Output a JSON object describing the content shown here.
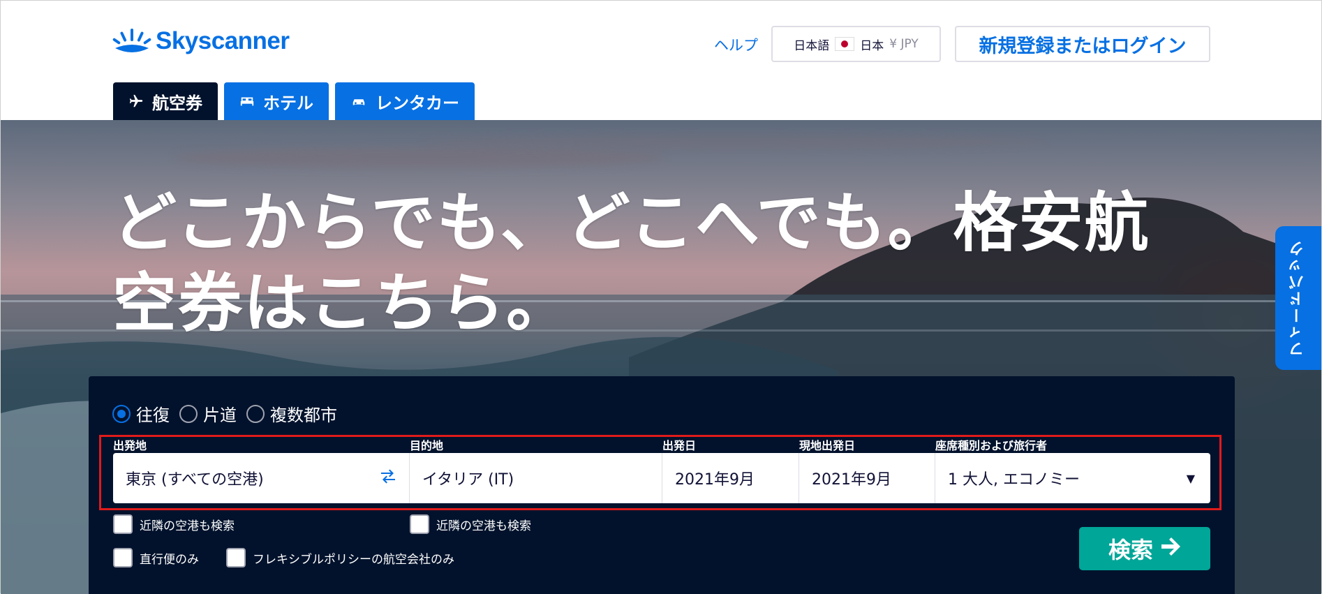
{
  "header": {
    "logo_text": "Skyscanner",
    "help_label": "ヘルプ",
    "locale": {
      "language": "日本語",
      "country": "日本",
      "currency": "¥ JPY"
    },
    "login_label": "新規登録またはログイン"
  },
  "tabs": [
    {
      "label": "航空券",
      "icon": "airplane-icon",
      "active": true
    },
    {
      "label": "ホテル",
      "icon": "bed-icon",
      "active": false
    },
    {
      "label": "レンタカー",
      "icon": "car-icon",
      "active": false
    }
  ],
  "hero": {
    "headline": "どこからでも、どこへでも。格安航空券はこちら。",
    "feedback_label": "フィードバック"
  },
  "search": {
    "trip_types": [
      {
        "label": "往復",
        "checked": true
      },
      {
        "label": "片道",
        "checked": false
      },
      {
        "label": "複数都市",
        "checked": false
      }
    ],
    "fields": {
      "origin": {
        "label": "出発地",
        "value": "東京 (すべての空港)"
      },
      "destination": {
        "label": "目的地",
        "value": "イタリア (IT)"
      },
      "depart": {
        "label": "出発日",
        "value": "2021年9月"
      },
      "return": {
        "label": "現地出発日",
        "value": "2021年9月"
      },
      "cabin": {
        "label": "座席種別および旅行者",
        "value": "1 大人, エコノミー"
      }
    },
    "options": {
      "nearby_origin": "近隣の空港も検索",
      "nearby_destination": "近隣の空港も検索",
      "direct_only": "直行便のみ",
      "flexible_only": "フレキシブルポリシーの航空会社のみ"
    },
    "search_label": "検索"
  },
  "colors": {
    "brand_blue": "#0770e3",
    "panel_navy": "#02122c",
    "search_green": "#00a698",
    "highlight_red": "#e01b1b"
  }
}
